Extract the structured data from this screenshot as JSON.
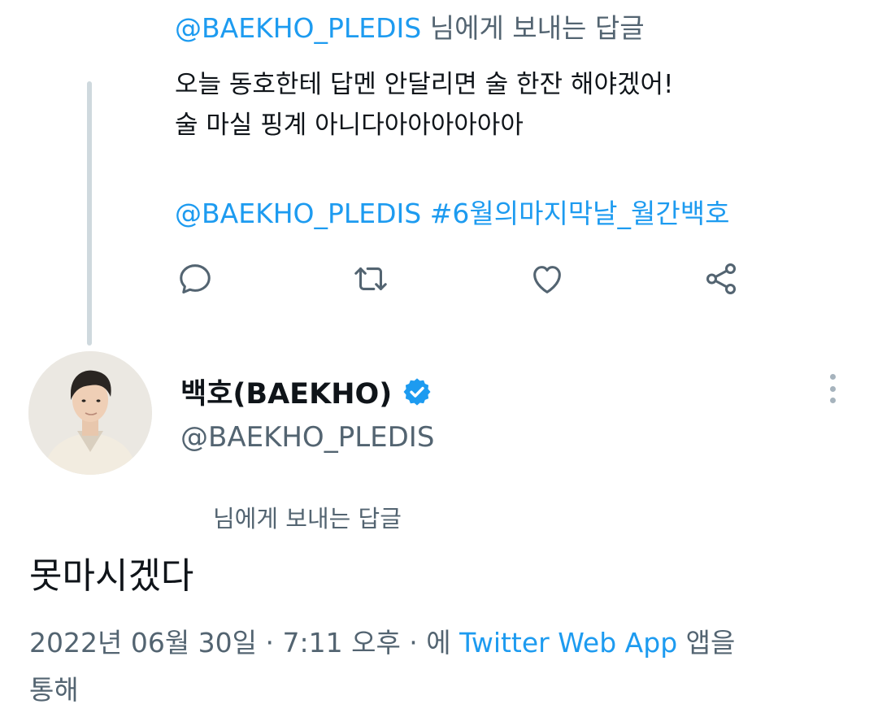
{
  "previous_tweet": {
    "reply_to": {
      "handle": "@BAEKHO_PLEDIS",
      "suffix": "님에게 보내는 답글"
    },
    "text_line_1": "오늘 동호한테 답멘 안달리면 술 한잔 해야겠어!",
    "text_line_2": "술 마실 핑계 아니다아아아아아아",
    "mention": "@BAEKHO_PLEDIS",
    "hashtag": "#6월의마지막날_월간백호",
    "actions": [
      {
        "name": "reply",
        "icon": "comment-icon"
      },
      {
        "name": "retweet",
        "icon": "retweet-icon"
      },
      {
        "name": "like",
        "icon": "heart-icon"
      },
      {
        "name": "share",
        "icon": "share-icon"
      }
    ]
  },
  "main_tweet": {
    "display_name": "백호(BAEKHO)",
    "handle": "@BAEKHO_PLEDIS",
    "verified_icon": "verified-badge-icon",
    "reply_to_suffix": "님에게 보내는 답글",
    "text": "못마시겠다",
    "timestamp": "2022년 06월 30일 · 7:11 오후 · 에",
    "source_app": "Twitter Web App",
    "source_suffix": "앱을",
    "source_suffix_2": "통해"
  },
  "colors": {
    "accent": "#1d9bf0",
    "secondary_text": "#536471",
    "primary_text": "#0f1419",
    "thread_line": "#cfd9de"
  }
}
